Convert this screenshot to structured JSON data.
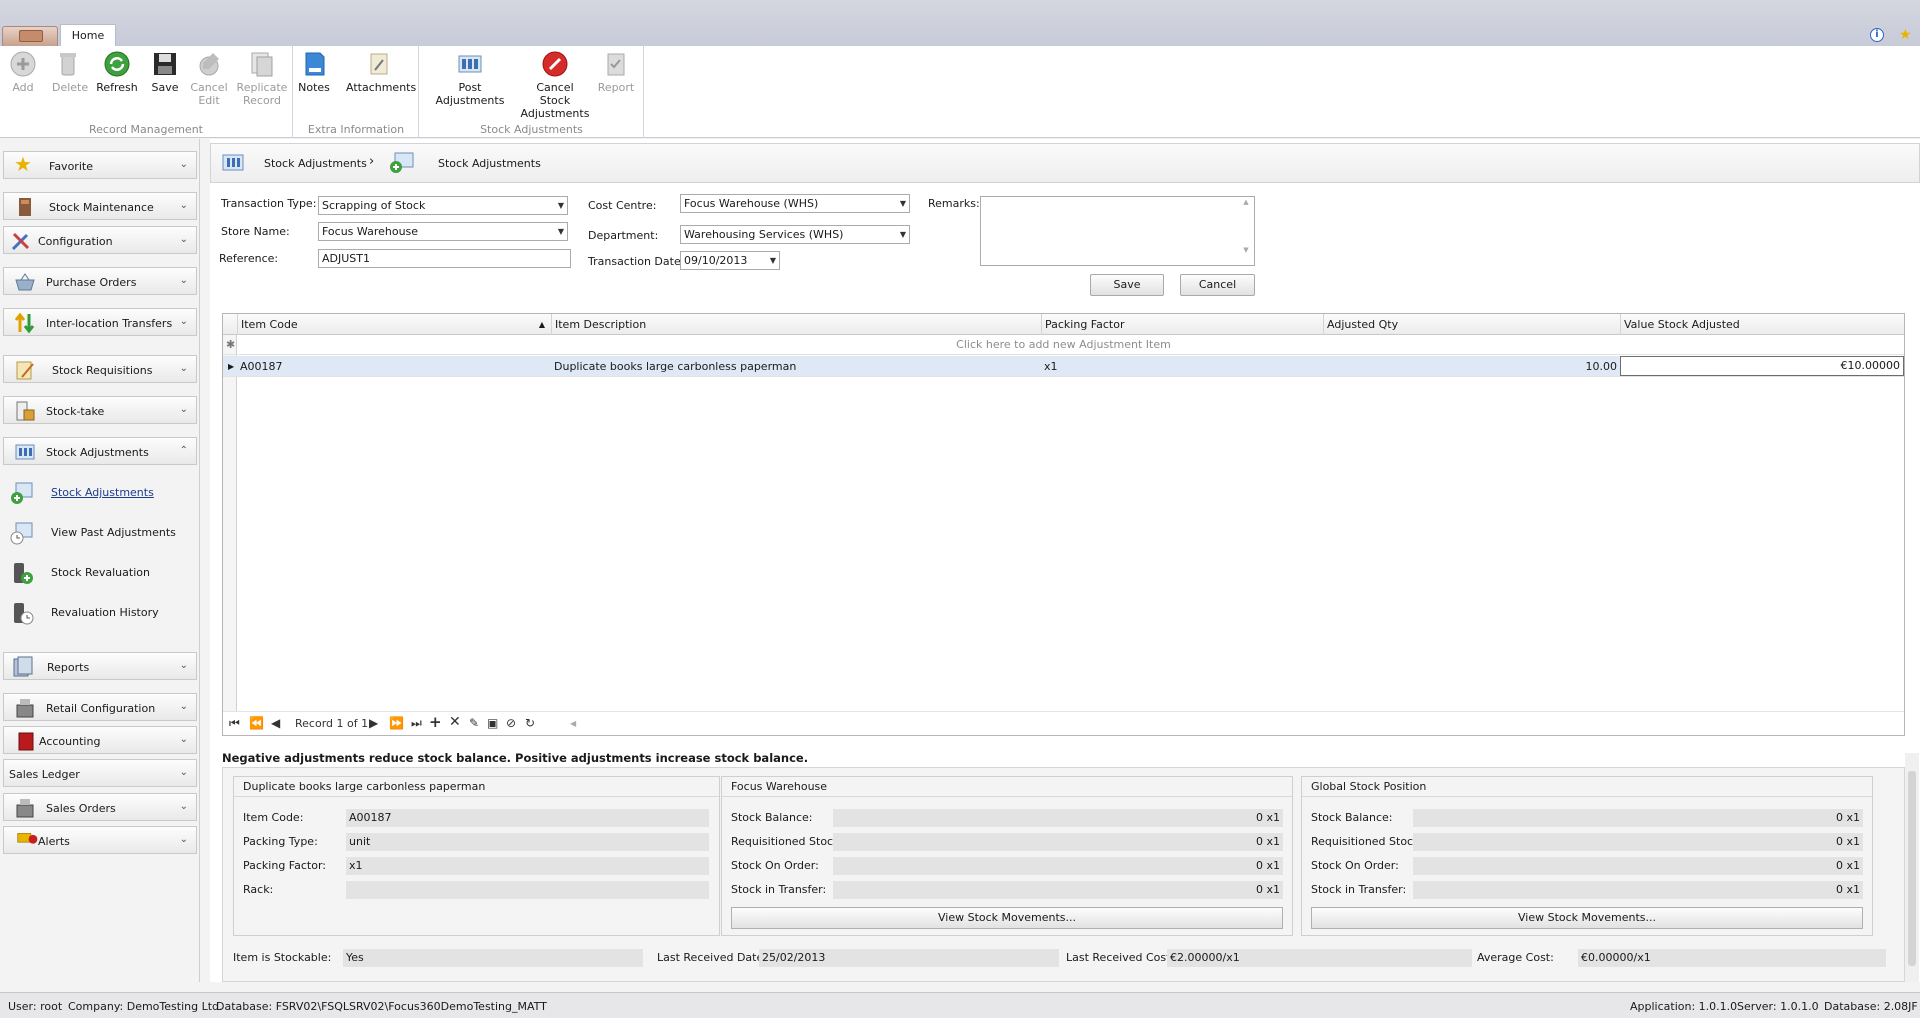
{
  "ribbon": {
    "tab": "Home",
    "groups": {
      "record_management": "Record Management",
      "extra_information": "Extra Information",
      "stock_adjustments": "Stock Adjustments"
    },
    "buttons": {
      "add": "Add",
      "delete": "Delete",
      "refresh": "Refresh",
      "save": "Save",
      "cancel_edit_1": "Cancel",
      "cancel_edit_2": "Edit",
      "replicate_1": "Replicate",
      "replicate_2": "Record",
      "notes": "Notes",
      "attachments": "Attachments",
      "post_adjustments": "Post Adjustments",
      "cancel_stock_1": "Cancel Stock",
      "cancel_stock_2": "Adjustments",
      "report": "Report"
    }
  },
  "sidebar": {
    "favorite": "Favorite",
    "stock_maintenance": "Stock Maintenance",
    "configuration": "Configuration",
    "purchase_orders": "Purchase Orders",
    "inter_location": "Inter-location Transfers",
    "stock_requisitions": "Stock Requisitions",
    "stock_take": "Stock-take",
    "stock_adjustments": "Stock Adjustments",
    "sub_stock_adjustments": "Stock Adjustments",
    "sub_view_past": "View Past Adjustments",
    "sub_revaluation": "Stock Revaluation",
    "sub_revaluation_history": "Revaluation History",
    "reports": "Reports",
    "retail_configuration": "Retail Configuration",
    "accounting": "Accounting",
    "sales_ledger": "Sales Ledger",
    "sales_orders": "Sales Orders",
    "alerts": "Alerts"
  },
  "breadcrumb": {
    "first": "Stock Adjustments",
    "separator": "›",
    "second": "Stock Adjustments"
  },
  "form": {
    "transaction_type_label": "Transaction Type:",
    "transaction_type": "Scrapping of Stock",
    "store_name_label": "Store Name:",
    "store_name": "Focus Warehouse",
    "reference_label": "Reference:",
    "reference": "ADJUST1",
    "cost_centre_label": "Cost Centre:",
    "cost_centre": "Focus Warehouse (WHS)",
    "department_label": "Department:",
    "department": "Warehousing Services (WHS)",
    "transaction_date_label": "Transaction Date:",
    "transaction_date": "09/10/2013",
    "remarks_label": "Remarks:",
    "save": "Save",
    "cancel": "Cancel"
  },
  "grid": {
    "columns": [
      "Item Code",
      "Item Description",
      "Packing Factor",
      "Adjusted Qty",
      "Value Stock Adjusted"
    ],
    "new_row_hint": "Click here to add new Adjustment Item",
    "rows": [
      {
        "item_code": "A00187",
        "description": "Duplicate  books large carbonless paperman",
        "packing_factor": "x1",
        "adjusted_qty": "10.00",
        "value": "€10.00000"
      }
    ],
    "record_text": "Record 1 of 1"
  },
  "note": "Negative adjustments reduce stock balance. Positive adjustments increase stock balance.",
  "detail": {
    "item_panel": {
      "title": "Duplicate  books large carbonless paperman",
      "item_code_label": "Item Code:",
      "item_code": "A00187",
      "packing_type_label": "Packing Type:",
      "packing_type": "unit",
      "packing_factor_label": "Packing Factor:",
      "packing_factor": "x1",
      "rack_label": "Rack:",
      "rack": ""
    },
    "warehouse_panel": {
      "title": "Focus Warehouse",
      "balance_label": "Stock Balance:",
      "balance": "0 x1",
      "requisitioned_label": "Requisitioned Stock:",
      "requisitioned": "0 x1",
      "on_order_label": "Stock On Order:",
      "on_order": "0 x1",
      "in_transfer_label": "Stock in Transfer:",
      "in_transfer": "0 x1",
      "movements_button": "View Stock Movements..."
    },
    "global_panel": {
      "title": "Global Stock Position",
      "balance_label": "Stock Balance:",
      "balance": "0 x1",
      "requisitioned_label": "Requisitioned Stock:",
      "requisitioned": "0 x1",
      "on_order_label": "Stock On Order:",
      "on_order": "0 x1",
      "in_transfer_label": "Stock in Transfer:",
      "in_transfer": "0 x1",
      "movements_button": "View Stock Movements..."
    },
    "stockable_label": "Item is Stockable:",
    "stockable": "Yes",
    "last_received_date_label": "Last Received Date:",
    "last_received_date": "25/02/2013",
    "last_received_cost_label": "Last Received Cost:",
    "last_received_cost": "€2.00000/x1",
    "average_cost_label": "Average Cost:",
    "average_cost": "€0.00000/x1"
  },
  "status": {
    "user": "User: root",
    "company": "Company: DemoTesting Ltd.",
    "database": "Database: FSRV02\\FSQLSRV02\\Focus360DemoTesting_MATT",
    "application": "Application: 1.0.1.0",
    "server": "Server: 1.0.1.0",
    "db_version": "Database: 2.08JF"
  },
  "colors": {
    "ribbon_bg": "#ffffff",
    "titlebar": "#c8cbd8",
    "selected_row": "#dfe9f5",
    "link": "#1c3c8c"
  }
}
